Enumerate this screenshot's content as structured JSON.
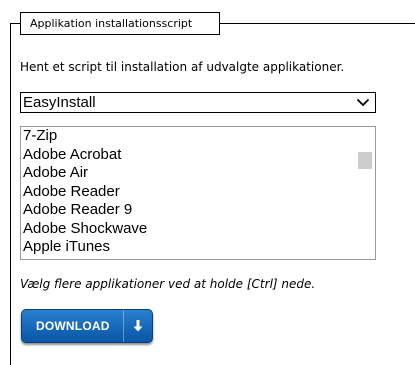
{
  "section": {
    "legend": "Applikation installationsscript"
  },
  "description": "Hent et script til installation af udvalgte applikationer.",
  "installer_select": {
    "selected": "EasyInstall"
  },
  "applications": [
    "7-Zip",
    "Adobe Acrobat",
    "Adobe Air",
    "Adobe Reader",
    "Adobe Reader 9",
    "Adobe Shockwave",
    "Apple iTunes"
  ],
  "hint": "Vælg flere applikationer ved at holde [Ctrl] nede.",
  "download_button": {
    "label": "DOWNLOAD",
    "icon": "download-arrow-icon"
  },
  "colors": {
    "button_blue": "#0a55a6"
  }
}
